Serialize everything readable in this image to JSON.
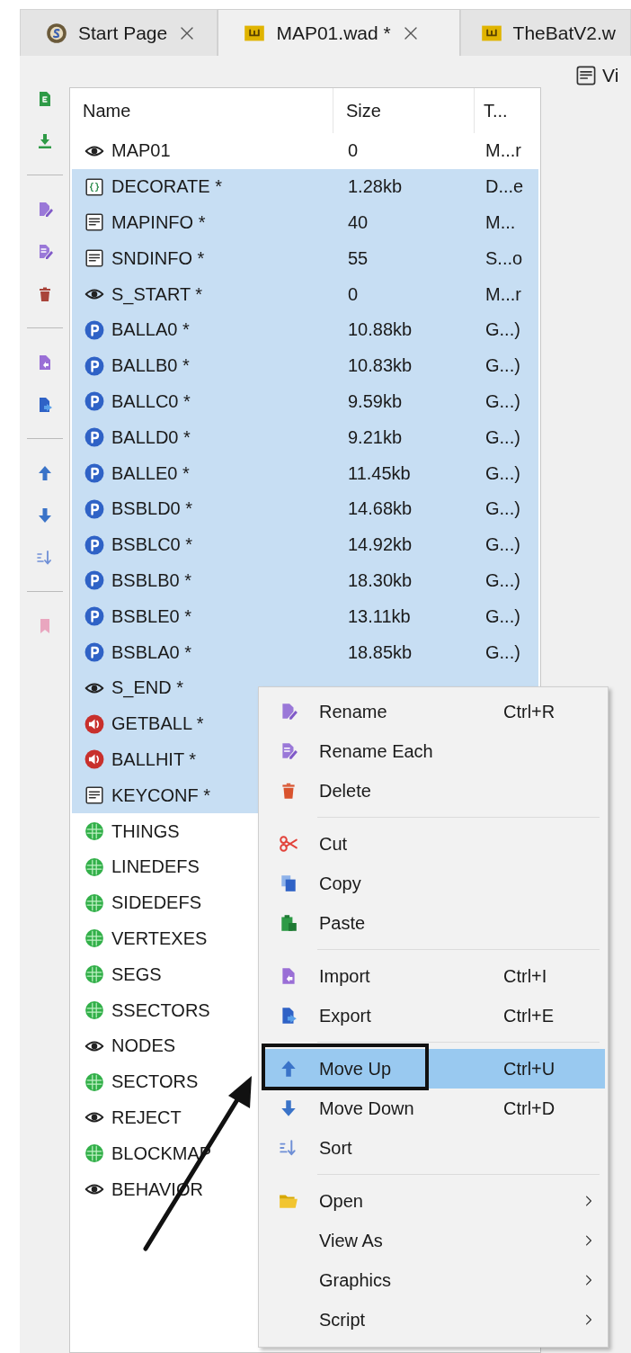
{
  "tabs": [
    {
      "label": "Start Page",
      "closable": true,
      "selected": false
    },
    {
      "label": "MAP01.wad *",
      "closable": true,
      "selected": true
    },
    {
      "label": "TheBatV2.w",
      "closable": false,
      "selected": false
    }
  ],
  "entry_list": {
    "columns": [
      "Name",
      "Size",
      "T..."
    ],
    "rows": [
      {
        "name": "MAP01",
        "size": "0",
        "type": "M...r",
        "kind": "map",
        "selected": false
      },
      {
        "name": "DECORATE *",
        "size": "1.28kb",
        "type": "D...e",
        "kind": "script",
        "selected": true
      },
      {
        "name": "MAPINFO *",
        "size": "40",
        "type": "M...",
        "kind": "text",
        "selected": true
      },
      {
        "name": "SNDINFO *",
        "size": "55",
        "type": "S...o",
        "kind": "text",
        "selected": true
      },
      {
        "name": "S_START *",
        "size": "0",
        "type": "M...r",
        "kind": "map",
        "selected": true
      },
      {
        "name": "BALLA0 *",
        "size": "10.88kb",
        "type": "G...)",
        "kind": "patch",
        "selected": true
      },
      {
        "name": "BALLB0 *",
        "size": "10.83kb",
        "type": "G...)",
        "kind": "patch",
        "selected": true
      },
      {
        "name": "BALLC0 *",
        "size": "9.59kb",
        "type": "G...)",
        "kind": "patch",
        "selected": true
      },
      {
        "name": "BALLD0 *",
        "size": "9.21kb",
        "type": "G...)",
        "kind": "patch",
        "selected": true
      },
      {
        "name": "BALLE0 *",
        "size": "11.45kb",
        "type": "G...)",
        "kind": "patch",
        "selected": true
      },
      {
        "name": "BSBLD0 *",
        "size": "14.68kb",
        "type": "G...)",
        "kind": "patch",
        "selected": true
      },
      {
        "name": "BSBLC0 *",
        "size": "14.92kb",
        "type": "G...)",
        "kind": "patch",
        "selected": true
      },
      {
        "name": "BSBLB0 *",
        "size": "18.30kb",
        "type": "G...)",
        "kind": "patch",
        "selected": true
      },
      {
        "name": "BSBLE0 *",
        "size": "13.11kb",
        "type": "G...)",
        "kind": "patch",
        "selected": true
      },
      {
        "name": "BSBLA0 *",
        "size": "18.85kb",
        "type": "G...)",
        "kind": "patch",
        "selected": true
      },
      {
        "name": "S_END *",
        "kind": "map",
        "selected": true
      },
      {
        "name": "GETBALL *",
        "kind": "sound",
        "selected": true
      },
      {
        "name": "BALLHIT *",
        "kind": "sound",
        "selected": true
      },
      {
        "name": "KEYCONF *",
        "kind": "text",
        "selected": true
      },
      {
        "name": "THINGS",
        "kind": "data",
        "selected": false
      },
      {
        "name": "LINEDEFS",
        "kind": "data",
        "selected": false
      },
      {
        "name": "SIDEDEFS",
        "kind": "data",
        "selected": false
      },
      {
        "name": "VERTEXES",
        "kind": "data",
        "selected": false
      },
      {
        "name": "SEGS",
        "kind": "data",
        "selected": false
      },
      {
        "name": "SSECTORS",
        "kind": "data",
        "selected": false
      },
      {
        "name": "NODES",
        "kind": "map",
        "selected": false
      },
      {
        "name": "SECTORS",
        "kind": "data",
        "selected": false
      },
      {
        "name": "REJECT",
        "kind": "map",
        "selected": false
      },
      {
        "name": "BLOCKMAP",
        "kind": "data",
        "selected": false
      },
      {
        "name": "BEHAVIOR",
        "kind": "map",
        "selected": false
      }
    ]
  },
  "view_pane": {
    "label": "Vi"
  },
  "context_menu": {
    "items": [
      {
        "kind": "item",
        "label": "Rename",
        "shortcut": "Ctrl+R",
        "submenu": false,
        "selected": false
      },
      {
        "kind": "item",
        "label": "Rename Each",
        "submenu": false,
        "selected": false
      },
      {
        "kind": "item",
        "label": "Delete",
        "submenu": false,
        "selected": false
      },
      {
        "kind": "separator"
      },
      {
        "kind": "item",
        "label": "Cut",
        "submenu": false,
        "selected": false
      },
      {
        "kind": "item",
        "label": "Copy",
        "submenu": false,
        "selected": false
      },
      {
        "kind": "item",
        "label": "Paste",
        "submenu": false,
        "selected": false
      },
      {
        "kind": "separator"
      },
      {
        "kind": "item",
        "label": "Import",
        "shortcut": "Ctrl+I",
        "submenu": false,
        "selected": false
      },
      {
        "kind": "item",
        "label": "Export",
        "shortcut": "Ctrl+E",
        "submenu": false,
        "selected": false
      },
      {
        "kind": "separator"
      },
      {
        "kind": "item",
        "label": "Move Up",
        "shortcut": "Ctrl+U",
        "submenu": false,
        "selected": true
      },
      {
        "kind": "item",
        "label": "Move Down",
        "shortcut": "Ctrl+D",
        "submenu": false,
        "selected": false
      },
      {
        "kind": "item",
        "label": "Sort",
        "submenu": false,
        "selected": false
      },
      {
        "kind": "separator"
      },
      {
        "kind": "item",
        "label": "Open",
        "submenu": true,
        "selected": false
      },
      {
        "kind": "item",
        "label": "View As",
        "submenu": true,
        "selected": false
      },
      {
        "kind": "item",
        "label": "Graphics",
        "submenu": true,
        "selected": false
      },
      {
        "kind": "item",
        "label": "Script",
        "submenu": true,
        "selected": false
      }
    ]
  }
}
